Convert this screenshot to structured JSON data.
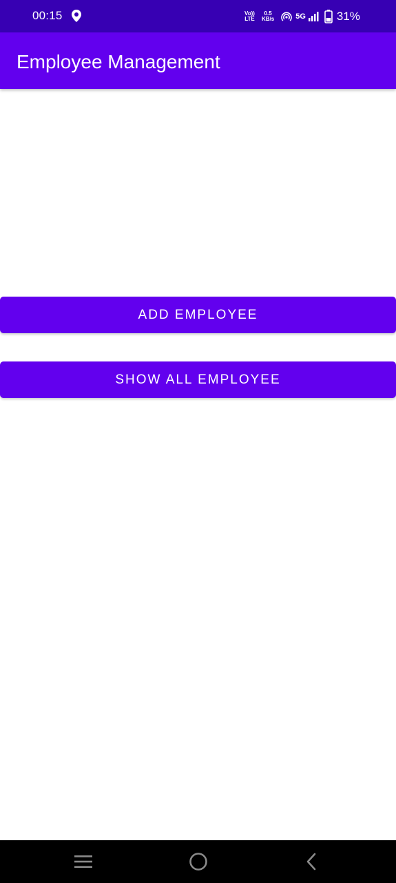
{
  "status_bar": {
    "time": "00:15",
    "volte_top": "Vo))",
    "volte_bottom": "LTE",
    "speed_value": "0.5",
    "speed_unit": "KB/s",
    "network": "5G",
    "battery": "31%",
    "icons": [
      "location-icon",
      "hotspot-icon",
      "signal-icon",
      "battery-icon"
    ]
  },
  "app_bar": {
    "title": "Employee Management"
  },
  "main": {
    "add_button_label": "ADD EMPLOYEE",
    "show_all_button_label": "SHOW ALL EMPLOYEE"
  },
  "nav_bar": {
    "icons": [
      "menu-icon",
      "home-icon",
      "back-icon"
    ]
  },
  "colors": {
    "primary": "#6200ee",
    "primary_dark": "#3700b3",
    "on_primary": "#ffffff",
    "background": "#ffffff",
    "nav_background": "#000000"
  }
}
